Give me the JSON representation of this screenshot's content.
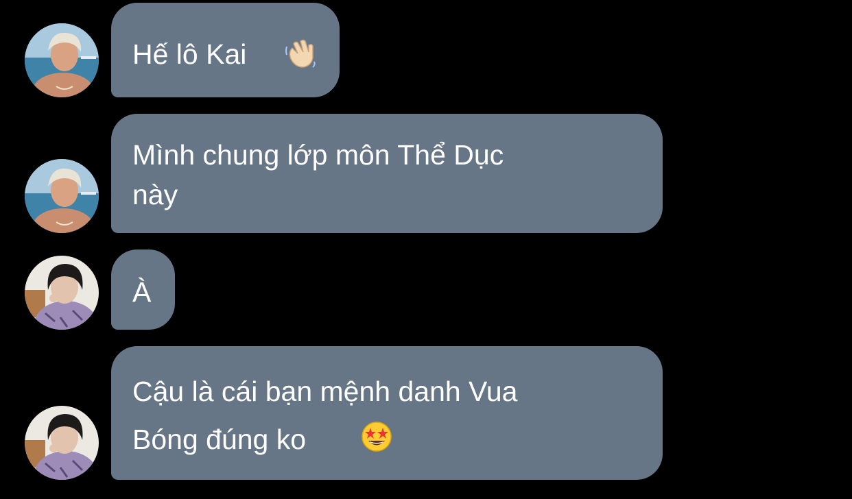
{
  "messages": [
    {
      "sender": "friend",
      "lines": [
        "Hế lô Kai"
      ],
      "emoji_icon": "waving-hand-icon"
    },
    {
      "sender": "friend",
      "lines": [
        "Mình chung lớp môn Thể Dục",
        "này"
      ]
    },
    {
      "sender": "me",
      "lines": [
        "À"
      ]
    },
    {
      "sender": "me",
      "lines": [
        "Cậu là cái bạn mệnh danh Vua",
        "Bóng đúng ko"
      ],
      "emoji_icon": "star-struck-face-icon"
    }
  ],
  "colors": {
    "background": "#000000",
    "bubble": "#667686",
    "text": "#ffffff"
  }
}
